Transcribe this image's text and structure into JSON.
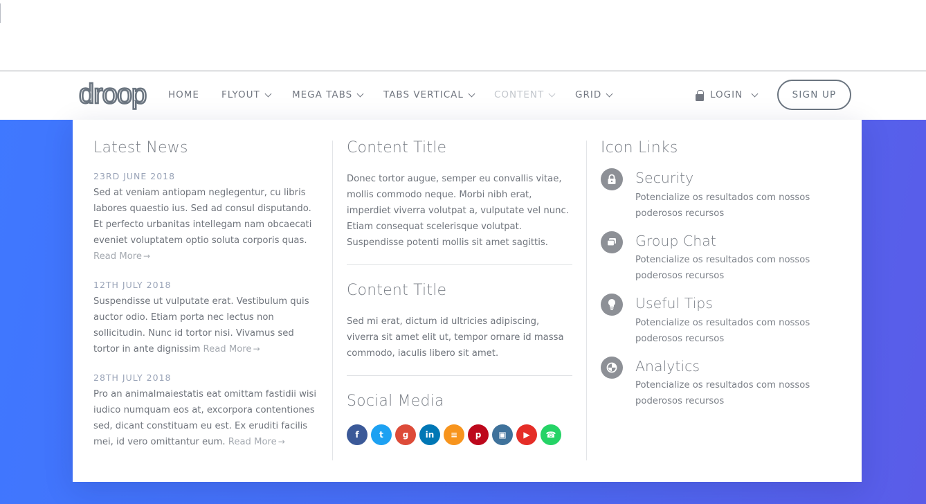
{
  "brand": {
    "logo_text": "droop"
  },
  "nav": {
    "items": [
      {
        "label": "HOME",
        "has_dropdown": false
      },
      {
        "label": "FLYOUT",
        "has_dropdown": true
      },
      {
        "label": "MEGA TABS",
        "has_dropdown": true
      },
      {
        "label": "TABS VERTICAL",
        "has_dropdown": true
      },
      {
        "label": "CONTENT",
        "has_dropdown": true,
        "active": true
      },
      {
        "label": "GRID",
        "has_dropdown": true
      }
    ],
    "login_label": "LOGIN",
    "signup_label": "SIGN UP"
  },
  "mega": {
    "news": {
      "title": "Latest News",
      "items": [
        {
          "date": "23rd June 2018",
          "text": "Sed at veniam antiopam neglegentur, cu libris labores quaestio ius. Sed ad consul disputando. Et perfecto urbanitas intellegam nam obcaecati eveniet voluptatem optio soluta corporis quas.",
          "read_more": "Read More"
        },
        {
          "date": "12th July 2018",
          "text": "Suspendisse ut vulputate erat. Vestibulum quis auctor odio. Etiam porta nec lectus non sollicitudin. Nunc id tortor nisi. Vivamus sed tortor in ante dignissim",
          "read_more": "Read More"
        },
        {
          "date": "28th July 2018",
          "text": "Pro an animalmaiestatis eat omittam fastidii wisi iudico numquam eos at, excorpora contentiones sed, dicant constituam eu est. Ex eruditi facilis mei, id vero omittantur eum.",
          "read_more": "Read More"
        }
      ]
    },
    "content": {
      "blocks": [
        {
          "title": "Content Title",
          "text": "Donec tortor augue, semper eu convallis vitae, mollis commodo neque. Morbi nibh erat, imperdiet viverra volutpat a, vulputate vel nunc. Etiam consequat scelerisque volutpat. Suspendisse potenti mollis sit amet sagittis."
        },
        {
          "title": "Content Title",
          "text": "Sed mi erat, dictum id ultricies adipiscing, viverra sit amet elit ut, tempor ornare id massa commodo, iaculis libero sit amet."
        }
      ],
      "social_title": "Social Media",
      "social": [
        {
          "name": "facebook-icon",
          "glyph": "f",
          "color": "#3b5998"
        },
        {
          "name": "twitter-icon",
          "glyph": "t",
          "color": "#1da1f2"
        },
        {
          "name": "google-plus-icon",
          "glyph": "g",
          "color": "#dd4b39"
        },
        {
          "name": "linkedin-icon",
          "glyph": "in",
          "color": "#0077b5"
        },
        {
          "name": "rss-icon",
          "glyph": "≡",
          "color": "#f7941d"
        },
        {
          "name": "pinterest-icon",
          "glyph": "p",
          "color": "#bd081c"
        },
        {
          "name": "instagram-icon",
          "glyph": "▣",
          "color": "#3f729b"
        },
        {
          "name": "youtube-icon",
          "glyph": "▶",
          "color": "#e52d27"
        },
        {
          "name": "whatsapp-icon",
          "glyph": "☎",
          "color": "#25d366"
        }
      ]
    },
    "icon_links": {
      "title": "Icon Links",
      "items": [
        {
          "icon": "lock-icon",
          "title": "Security",
          "desc": "Potencialize os resultados com nossos poderosos recursos"
        },
        {
          "icon": "chat-icon",
          "title": "Group Chat",
          "desc": "Potencialize os resultados com nossos poderosos recursos"
        },
        {
          "icon": "lightbulb-icon",
          "title": "Useful Tips",
          "desc": "Potencialize os resultados com nossos poderosos recursos"
        },
        {
          "icon": "pie-chart-icon",
          "title": "Analytics",
          "desc": "Potencialize os resultados com nossos poderosos recursos"
        }
      ]
    }
  },
  "colors": {
    "hero_start": "#3f78ff",
    "hero_end": "#5a5ce8",
    "text": "#6f747c",
    "date": "#9aa4b8"
  }
}
